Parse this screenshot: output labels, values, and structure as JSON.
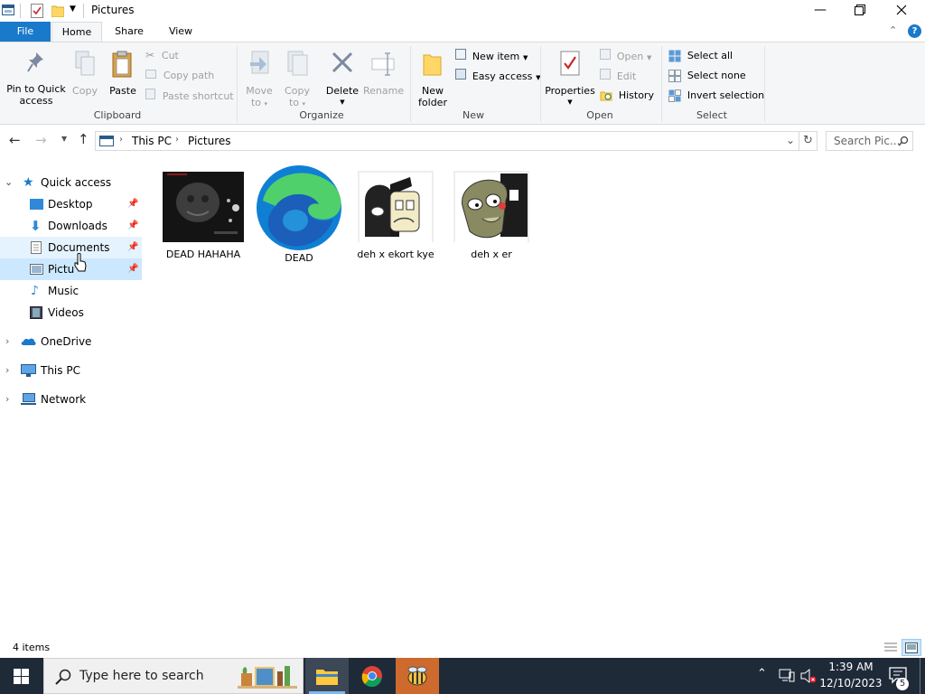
{
  "window": {
    "title": "Pictures"
  },
  "tabs": {
    "file": "File",
    "home": "Home",
    "share": "Share",
    "view": "View"
  },
  "ribbon": {
    "clipboard": {
      "pin_line1": "Pin to Quick",
      "pin_line2": "access",
      "copy": "Copy",
      "paste": "Paste",
      "cut": "Cut",
      "copy_path": "Copy path",
      "paste_shortcut": "Paste shortcut",
      "group": "Clipboard"
    },
    "organize": {
      "move_line1": "Move",
      "move_line2": "to",
      "copy_line1": "Copy",
      "copy_line2": "to",
      "delete": "Delete",
      "rename": "Rename",
      "group": "Organize"
    },
    "new": {
      "new_folder_line1": "New",
      "new_folder_line2": "folder",
      "new_item": "New item",
      "easy_access": "Easy access",
      "group": "New"
    },
    "open": {
      "properties": "Properties",
      "open": "Open",
      "edit": "Edit",
      "history": "History",
      "group": "Open"
    },
    "select": {
      "select_all": "Select all",
      "select_none": "Select none",
      "invert": "Invert selection",
      "group": "Select"
    }
  },
  "address": {
    "crumbs": [
      "This PC",
      "Pictures"
    ],
    "search_placeholder": "Search Pic..."
  },
  "nav": {
    "quick_access": "Quick access",
    "pinned": [
      "Desktop",
      "Downloads",
      "Documents",
      "Pictu"
    ],
    "others": [
      "Music",
      "Videos"
    ],
    "onedrive": "OneDrive",
    "this_pc": "This PC",
    "network": "Network"
  },
  "files": [
    {
      "name": "DEAD HAHAHA",
      "icon": "dark-image-thumbnail"
    },
    {
      "name": "DEAD",
      "icon": "edge-logo"
    },
    {
      "name": "deh x ekort kye",
      "icon": "cartoon-thumbnail"
    },
    {
      "name": "deh x er",
      "icon": "cartoon-thumbnail"
    }
  ],
  "status": {
    "count": "4 items"
  },
  "taskbar": {
    "search_placeholder": "Type here to search",
    "time": "1:39 AM",
    "date": "12/10/2023",
    "notifications": "5"
  },
  "colors": {
    "accent": "#1979ca",
    "selection": "#cce8ff",
    "taskbar": "#1f2a38"
  }
}
